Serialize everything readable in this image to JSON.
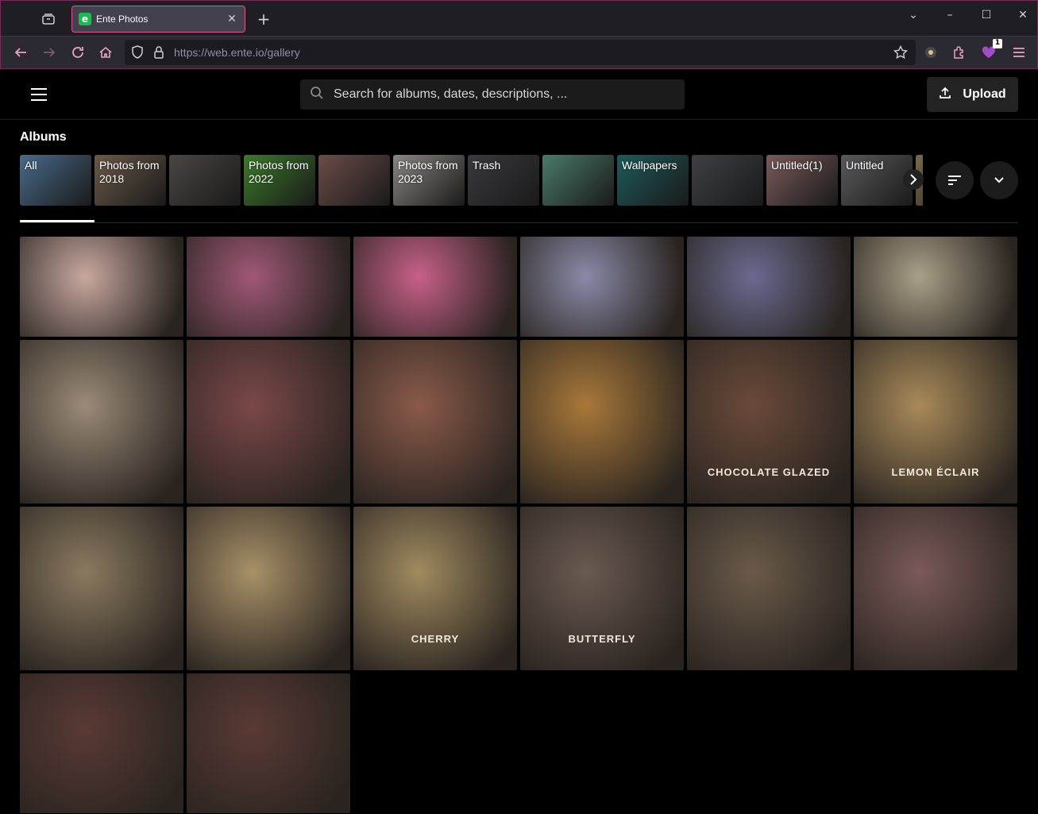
{
  "browser": {
    "tab_title": "Ente Photos",
    "tab_favicon_letter": "e",
    "url": "https://web.ente.io/gallery",
    "extension_badge": "1"
  },
  "header": {
    "search_placeholder": "Search for albums, dates, descriptions, ...",
    "upload_label": "Upload"
  },
  "albums": {
    "title": "Albums",
    "items": [
      {
        "name": "All",
        "color": "#4a6a8a"
      },
      {
        "name": "Photos from 2018",
        "color": "#6b5a48"
      },
      {
        "name": "",
        "color": "#4a4644"
      },
      {
        "name": "Photos from 2022",
        "color": "#3c7a2a"
      },
      {
        "name": "",
        "color": "#6a4c48"
      },
      {
        "name": "Photos from 2023",
        "color": "#8a8682"
      },
      {
        "name": "Trash",
        "color": "#3a3a3e"
      },
      {
        "name": "",
        "color": "#4a7a6a"
      },
      {
        "name": "Wallpapers",
        "color": "#1f5a5a"
      },
      {
        "name": "",
        "color": "#3e4044"
      },
      {
        "name": "Untitled(1)",
        "color": "#7a5a5a"
      },
      {
        "name": "Untitled",
        "color": "#5a5a5c"
      },
      {
        "name": "",
        "color": "#7a6a4a"
      }
    ]
  },
  "photos": [
    {
      "color": "#c8a8a0",
      "label": ""
    },
    {
      "color": "#a05878",
      "label": ""
    },
    {
      "color": "#c8608a",
      "label": ""
    },
    {
      "color": "#8a8aa8",
      "label": ""
    },
    {
      "color": "#6a6a90",
      "label": ""
    },
    {
      "color": "#a8a088",
      "label": ""
    },
    {
      "color": "#9a8a78",
      "label": ""
    },
    {
      "color": "#7a4848",
      "label": ""
    },
    {
      "color": "#8a5a4a",
      "label": ""
    },
    {
      "color": "#a8783a",
      "label": ""
    },
    {
      "color": "#6a4a3a",
      "label": "CHOCOLATE GLAZED"
    },
    {
      "color": "#a88a5a",
      "label": "LEMON ÉCLAIR"
    },
    {
      "color": "#8a7a60",
      "label": ""
    },
    {
      "color": "#a89068",
      "label": ""
    },
    {
      "color": "#a08a60",
      "label": "CHERRY"
    },
    {
      "color": "#6a5a50",
      "label": "BUTTERFLY"
    },
    {
      "color": "#6a5a4a",
      "label": ""
    },
    {
      "color": "#7a5a58",
      "label": ""
    },
    {
      "color": "#5a3a34",
      "label": ""
    },
    {
      "color": "#5a3a34",
      "label": ""
    }
  ]
}
